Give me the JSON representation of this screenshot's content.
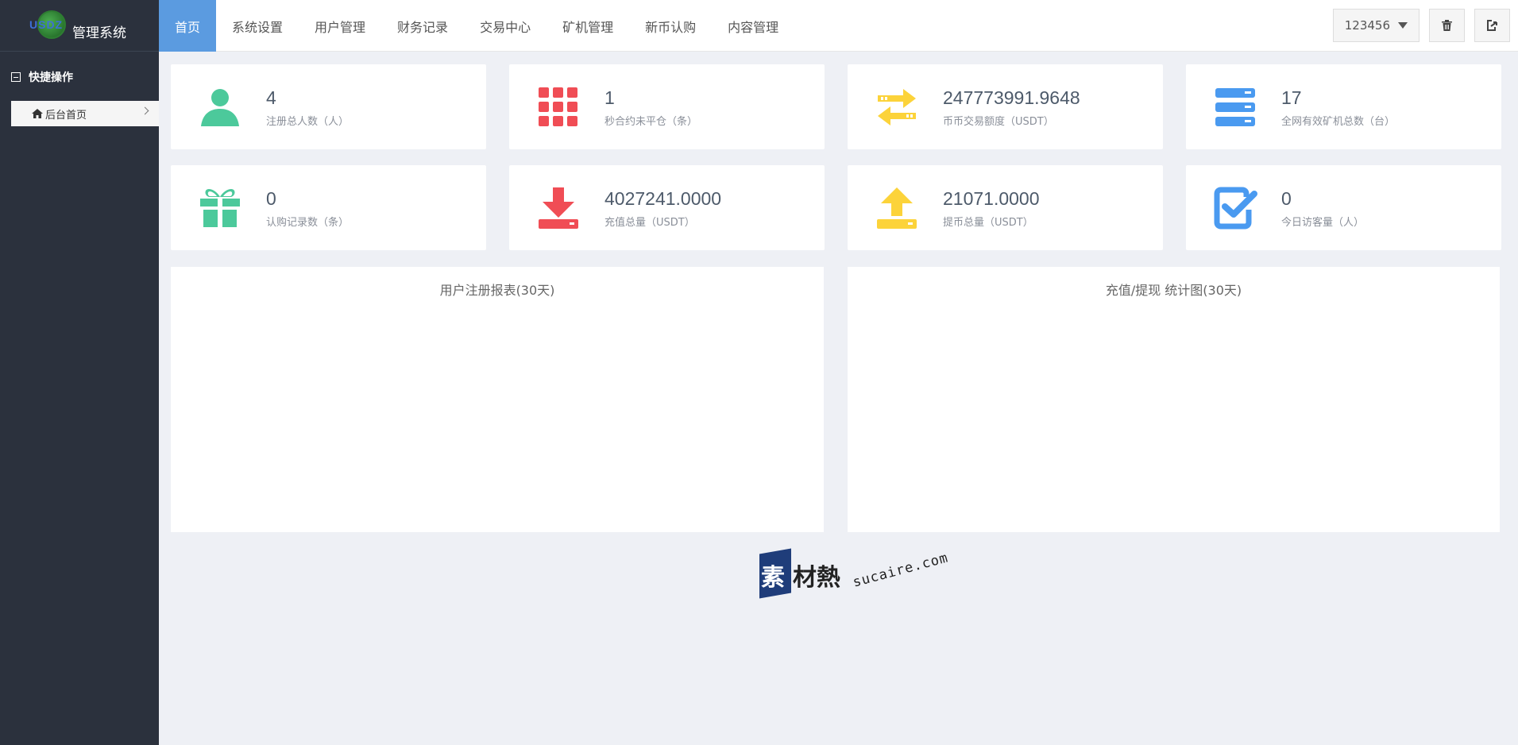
{
  "logo": {
    "mark_text": "USDZ",
    "title": "管理系统"
  },
  "sidebar": {
    "quick_ops_label": "快捷操作",
    "items": [
      {
        "label": "后台首页",
        "icon": "home-icon"
      }
    ]
  },
  "nav": {
    "items": [
      {
        "label": "首页",
        "active": true
      },
      {
        "label": "系统设置"
      },
      {
        "label": "用户管理"
      },
      {
        "label": "财务记录"
      },
      {
        "label": "交易中心"
      },
      {
        "label": "矿机管理"
      },
      {
        "label": "新币认购"
      },
      {
        "label": "内容管理"
      }
    ]
  },
  "topbar": {
    "username": "123456",
    "clear_icon": "trash-icon",
    "logout_icon": "logout-icon"
  },
  "stats": [
    {
      "value": "4",
      "label": "注册总人数（人）",
      "icon": "user-icon",
      "color": "#4cc99b"
    },
    {
      "value": "1",
      "label": "秒合约未平仓（条）",
      "icon": "grid-icon",
      "color": "#f04d55"
    },
    {
      "value": "247773991.9648",
      "label": "币币交易额度（USDT）",
      "icon": "exchange-icon",
      "color": "#fcd33a"
    },
    {
      "value": "17",
      "label": "全网有效矿机总数（台）",
      "icon": "server-icon",
      "color": "#4a9af0"
    },
    {
      "value": "0",
      "label": "认购记录数（条）",
      "icon": "gift-icon",
      "color": "#4cc99b"
    },
    {
      "value": "4027241.0000",
      "label": "充值总量（USDT）",
      "icon": "download-icon",
      "color": "#f04d55"
    },
    {
      "value": "21071.0000",
      "label": "提币总量（USDT）",
      "icon": "upload-icon",
      "color": "#fcd33a"
    },
    {
      "value": "0",
      "label": "今日访客量（人）",
      "icon": "check-square-icon",
      "color": "#4a9af0"
    }
  ],
  "panels": {
    "register_title": "用户注册报表(30天)",
    "finance_title": "充值/提现 统计图(30天)"
  },
  "watermark": {
    "cn": "素",
    "cn2": "材熱",
    "en": "sucaire.com"
  }
}
